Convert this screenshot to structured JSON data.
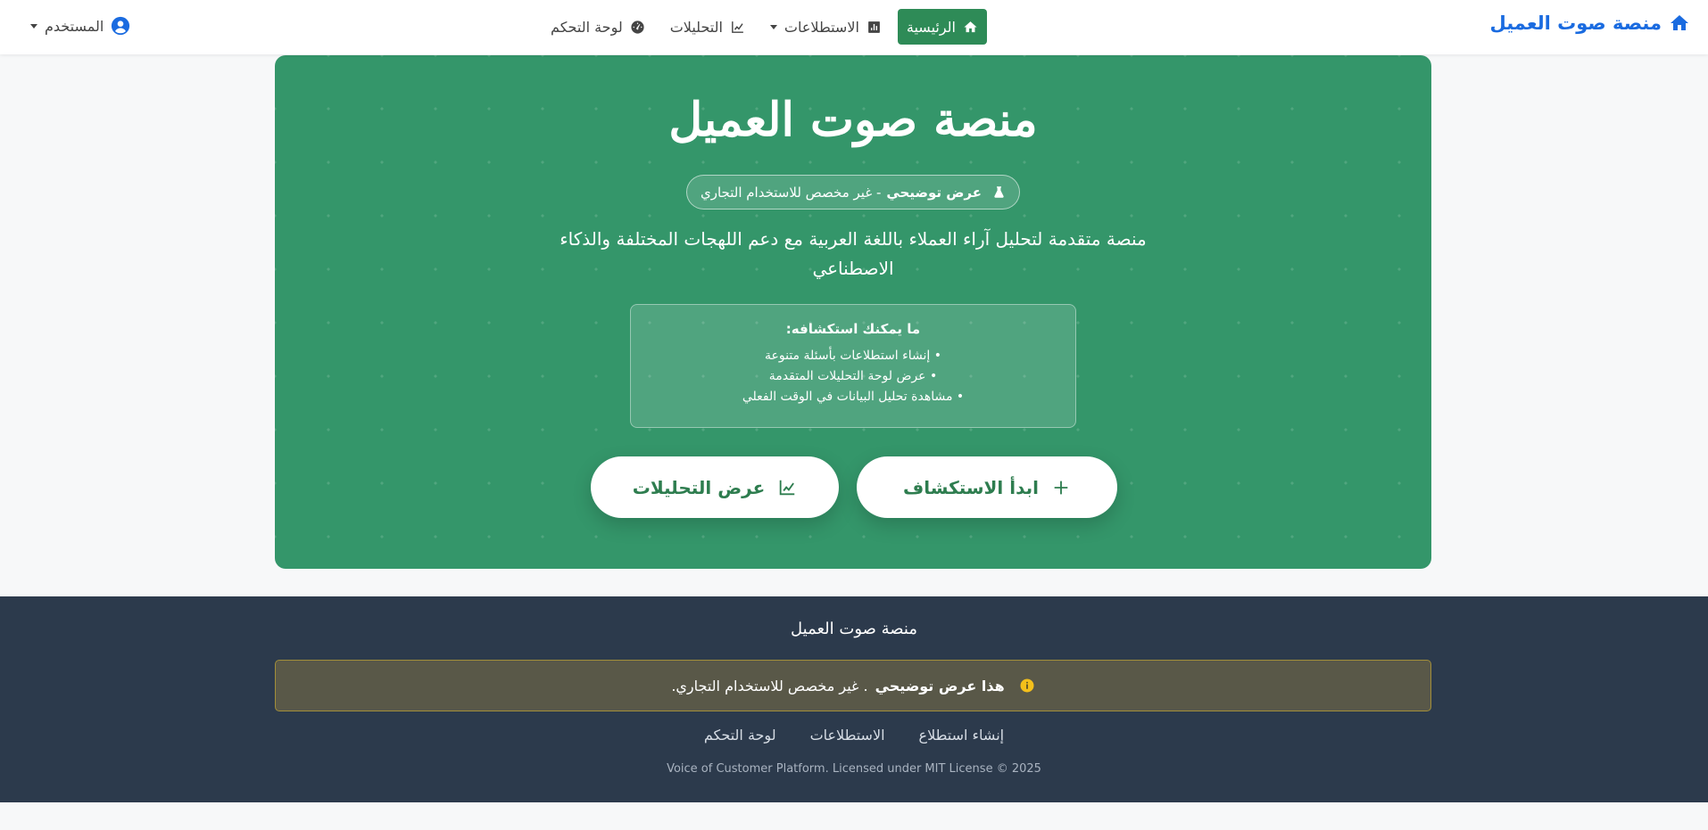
{
  "colors": {
    "brand": "#1a6be0",
    "primary_green": "#2e8b57",
    "hero_bg": "#34966a",
    "footer_bg": "#2c3a4c",
    "alert_border": "#a28e3a"
  },
  "navbar": {
    "brand_label": "منصة صوت العميل",
    "brand_icon": "home-icon",
    "items": [
      {
        "label": "الرئيسية",
        "icon": "home-icon",
        "active": true
      },
      {
        "label": "الاستطلاعات",
        "icon": "bar-chart-icon",
        "dropdown": true
      },
      {
        "label": "التحليلات",
        "icon": "line-chart-icon"
      },
      {
        "label": "لوحة التحكم",
        "icon": "gauge-icon"
      }
    ],
    "user_label": "المستخدم",
    "user_icon": "user-circle-icon"
  },
  "hero": {
    "title": "منصة صوت العميل",
    "badge_strong": "عرض توضيحي",
    "badge_rest": "- غير مخصص للاستخدام التجاري",
    "badge_icon": "flask-icon",
    "description": "منصة متقدمة لتحليل آراء العملاء باللغة العربية مع دعم اللهجات المختلفة والذكاء الاصطناعي",
    "explore": {
      "title": "ما يمكنك استكشافه:",
      "items": [
        "• إنشاء استطلاعات بأسئلة متنوعة",
        "• عرض لوحة التحليلات المتقدمة",
        "• مشاهدة تحليل البيانات في الوقت الفعلي"
      ]
    },
    "btn_start": {
      "label": "ابدأ الاستكشاف",
      "icon": "plus-icon"
    },
    "btn_analytics": {
      "label": "عرض التحليلات",
      "icon": "line-chart-icon"
    }
  },
  "footer": {
    "title": "منصة صوت العميل",
    "alert_strong": "هذا عرض توضيحي",
    "alert_rest": ". غير مخصص للاستخدام التجاري.",
    "alert_icon": "info-circle-icon",
    "links": [
      "إنشاء استطلاع",
      "الاستطلاعات",
      "لوحة التحكم"
    ],
    "copyright": "Voice of Customer Platform. Licensed under MIT License © 2025"
  }
}
